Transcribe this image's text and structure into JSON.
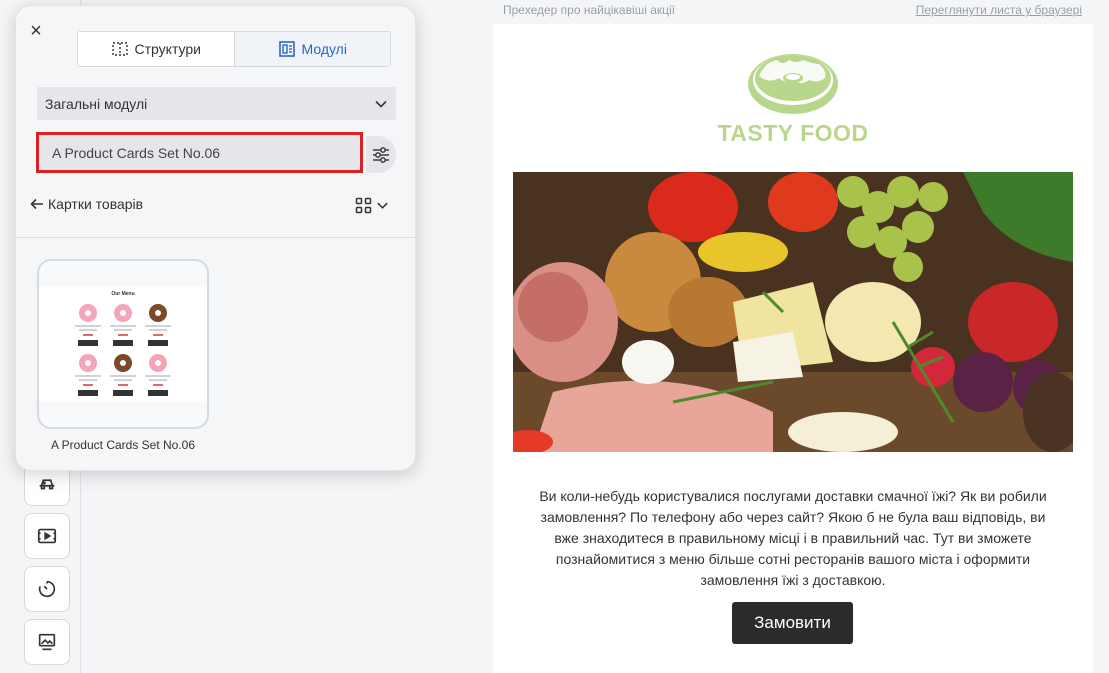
{
  "panel": {
    "close_glyph": "×",
    "tabs": [
      {
        "label": "Структури",
        "icon": "structure-icon",
        "active": false
      },
      {
        "label": "Модулі",
        "icon": "modules-icon",
        "active": true
      }
    ],
    "category_select": {
      "value": "Загальні модулі"
    },
    "search": {
      "value": "A Product Cards Set No.06"
    },
    "back_label": "Картки товарів",
    "modules": [
      {
        "title": "A Product Cards Set No.06",
        "preview_heading": "Our Menu"
      }
    ]
  },
  "left_toolbar": {
    "items": [
      "menu-icon",
      "video-icon",
      "timer-icon",
      "banner-icon"
    ]
  },
  "email": {
    "preheader": "Прехедер про найцікавіші акції",
    "view_in_browser": "Переглянути листа у браузері",
    "logo_text": "TASTY FOOD",
    "body_text": "Ви коли-небудь користувалися послугами доставки смачної їжі? Як ви робили замовлення? По телефону або через сайт? Якою б не була ваш відповідь, ви вже знаходитеся в правильному місці і в правильний час. Тут ви зможете познайомитися з меню більше сотні ресторанів вашого міста і оформити замовлення їжі з доставкою.",
    "button_label": "Замовити"
  },
  "colors": {
    "accent": "#2b67c7",
    "highlight_border": "#e02020",
    "logo_green": "#b8d78c",
    "button_dark": "#2b2b2b"
  }
}
